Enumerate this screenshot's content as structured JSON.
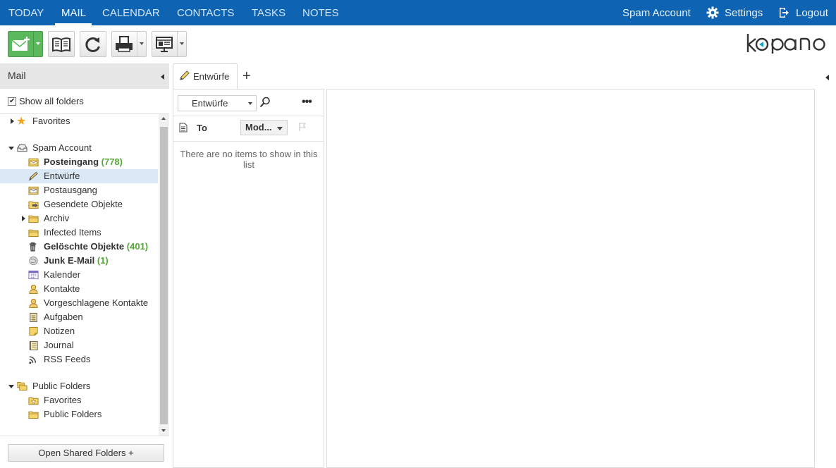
{
  "topnav": {
    "tabs": [
      {
        "label": "TODAY"
      },
      {
        "label": "MAIL"
      },
      {
        "label": "CALENDAR"
      },
      {
        "label": "CONTACTS"
      },
      {
        "label": "TASKS"
      },
      {
        "label": "NOTES"
      }
    ],
    "active_tab": "MAIL",
    "account": "Spam Account",
    "settings": "Settings",
    "logout": "Logout"
  },
  "brand": {
    "logo_alt": "kopano",
    "accent": "#0e64b3"
  },
  "toolbar": {
    "buttons": [
      "new-mail-icon",
      "address-book-icon",
      "refresh-icon",
      "print-icon",
      "layout-icon"
    ]
  },
  "sidebar": {
    "title": "Mail",
    "show_all_folders": "Show all folders",
    "show_all_checked": true,
    "favorites": "Favorites",
    "account": "Spam Account",
    "folders": [
      {
        "label": "Posteingang",
        "count": "(778)",
        "bold": true,
        "icon": "inbox-icon"
      },
      {
        "label": "Entwürfe",
        "count": "",
        "bold": false,
        "icon": "drafts-icon",
        "selected": true
      },
      {
        "label": "Postausgang",
        "count": "",
        "bold": false,
        "icon": "outbox-icon"
      },
      {
        "label": "Gesendete Objekte",
        "count": "",
        "bold": false,
        "icon": "sent-icon"
      },
      {
        "label": "Archiv",
        "count": "",
        "bold": false,
        "icon": "folder-icon",
        "expandable": true
      },
      {
        "label": "Infected Items",
        "count": "",
        "bold": false,
        "icon": "folder-icon"
      },
      {
        "label": "Gelöschte Objekte",
        "count": "(401)",
        "bold": true,
        "icon": "trash-icon"
      },
      {
        "label": "Junk E-Mail",
        "count": "(1)",
        "bold": true,
        "icon": "junk-icon"
      },
      {
        "label": "Kalender",
        "count": "",
        "bold": false,
        "icon": "calendar-icon"
      },
      {
        "label": "Kontakte",
        "count": "",
        "bold": false,
        "icon": "contact-icon"
      },
      {
        "label": "Vorgeschlagene Kontakte",
        "count": "",
        "bold": false,
        "icon": "contact-icon"
      },
      {
        "label": "Aufgaben",
        "count": "",
        "bold": false,
        "icon": "tasks-icon"
      },
      {
        "label": "Notizen",
        "count": "",
        "bold": false,
        "icon": "notes-icon"
      },
      {
        "label": "Journal",
        "count": "",
        "bold": false,
        "icon": "journal-icon"
      },
      {
        "label": "RSS Feeds",
        "count": "",
        "bold": false,
        "icon": "rss-icon"
      }
    ],
    "public_folders": "Public Folders",
    "public_children": [
      {
        "label": "Favorites",
        "icon": "star-folder-icon"
      },
      {
        "label": "Public Folders",
        "icon": "folder-icon"
      }
    ],
    "open_shared": "Open Shared Folders +"
  },
  "content": {
    "tab_label": "Entwürfe",
    "add_tab": "+",
    "folder_select": "Entwürfe",
    "more": "•••",
    "col_to": "To",
    "sort_label": "Mod...",
    "empty_message": "There are no items to show in this list"
  }
}
